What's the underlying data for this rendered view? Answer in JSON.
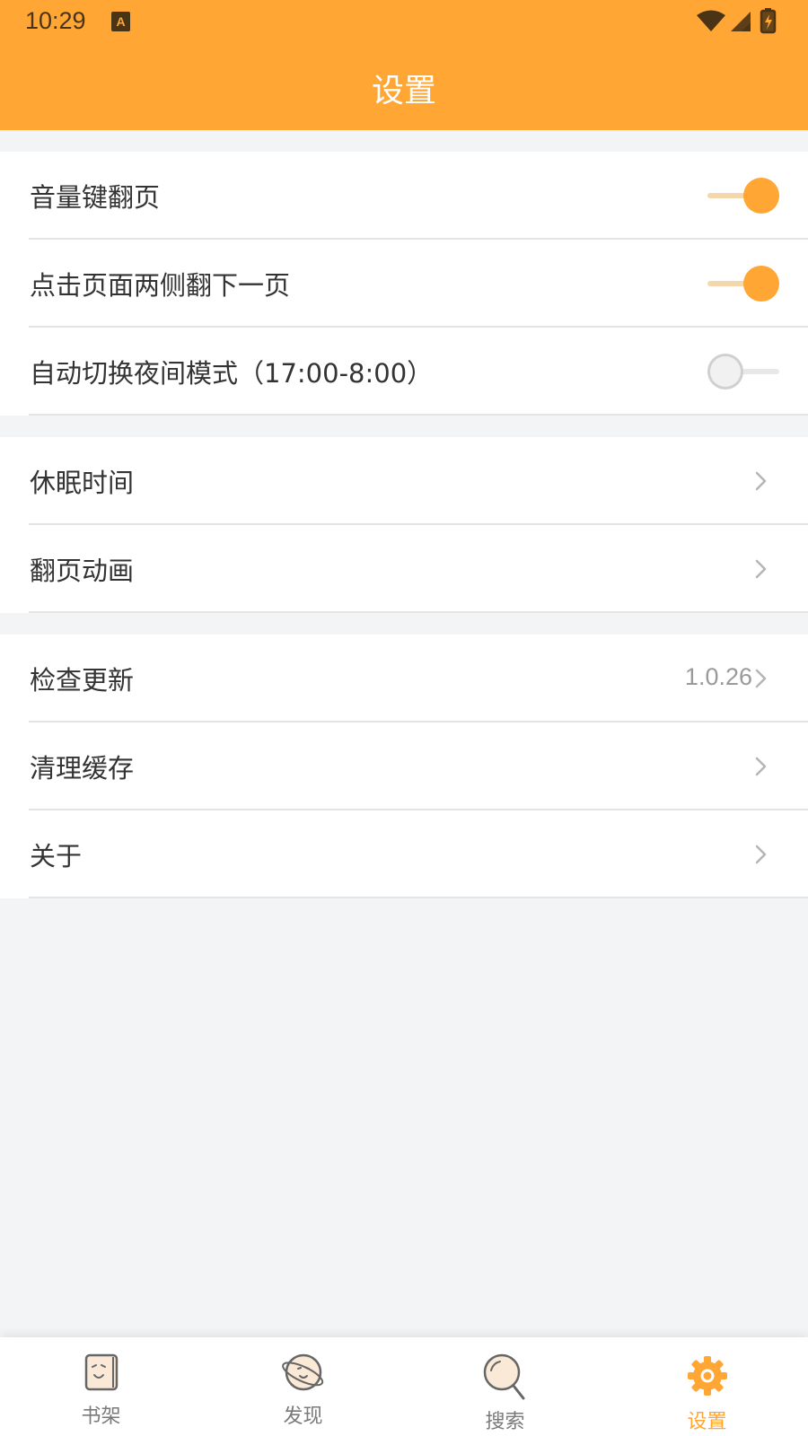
{
  "status_bar": {
    "time": "10:29",
    "notification_icon": "A"
  },
  "header": {
    "title": "设置"
  },
  "settings": {
    "volume_key_page_turn": {
      "label": "音量键翻页",
      "enabled": true
    },
    "tap_sides_next_page": {
      "label": "点击页面两侧翻下一页",
      "enabled": true
    },
    "auto_night_mode": {
      "label": "自动切换夜间模式（17:00-8:00）",
      "enabled": false
    },
    "sleep_time": {
      "label": "休眠时间"
    },
    "page_animation": {
      "label": "翻页动画"
    },
    "check_update": {
      "label": "检查更新",
      "value": "1.0.26"
    },
    "clear_cache": {
      "label": "清理缓存"
    },
    "about": {
      "label": "关于"
    }
  },
  "tabbar": {
    "tabs": [
      {
        "label": "书架",
        "icon": "bookshelf-icon",
        "active": false
      },
      {
        "label": "发现",
        "icon": "planet-icon",
        "active": false
      },
      {
        "label": "搜索",
        "icon": "search-icon",
        "active": false
      },
      {
        "label": "设置",
        "icon": "gear-icon",
        "active": true
      }
    ]
  },
  "colors": {
    "accent": "#ffa634",
    "background": "#f3f4f6",
    "text": "#333333",
    "muted": "#9a9a9a"
  }
}
